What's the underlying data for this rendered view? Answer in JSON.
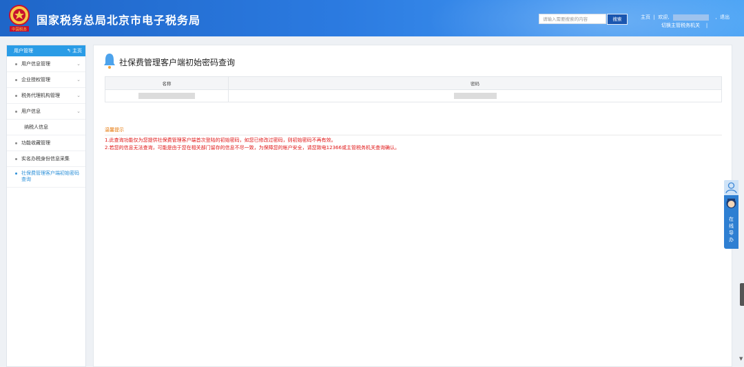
{
  "header": {
    "site_title": "国家税务总局北京市电子税务局",
    "emblem_text": "中国税务",
    "search_placeholder": "请输入需要搜索的内容",
    "search_button": "搜索",
    "home_link": "主页",
    "welcome": "欢迎,",
    "logout": "退出",
    "switch_authority": "切换主管税务机关"
  },
  "sidebar": {
    "header_label": "用户管理",
    "home_link": "主页",
    "items": [
      {
        "label": "用户信息管理",
        "expandable": true
      },
      {
        "label": "企业授权管理",
        "expandable": true
      },
      {
        "label": "税务代理机构管理",
        "expandable": true
      },
      {
        "label": "用户信息",
        "expandable": true
      },
      {
        "label": "纳税人信息",
        "sub": true
      },
      {
        "label": "功能收藏管理"
      },
      {
        "label": "实名办税身份信息采集"
      },
      {
        "label": "社保费管理客户端初始密码查询",
        "active": true
      }
    ]
  },
  "main": {
    "page_title": "社保费管理客户端初始密码查询",
    "table": {
      "headers": [
        "名称",
        "密码"
      ]
    },
    "tips": {
      "title": "温馨提示",
      "lines": [
        "1.此查询功能仅为您提供社保费管理客户端首次登陆的初始密码，如您已修改过密码，则初始密码不再有效。",
        "2.若您的信息无法查询，可能是由于您在相关部门留存的信息不尽一致，为保障您的帐户安全，请您致电12366或主管税务机关查询确认。"
      ]
    }
  },
  "float_widget": {
    "label_chars": [
      "在",
      "线",
      "导",
      "办"
    ]
  },
  "colors": {
    "header_blue": "#2b7ae0",
    "sidebar_head": "#2a9ce6",
    "tip_title": "#e6780a",
    "tip_text": "#e01414",
    "active_item": "#2a8fd8"
  }
}
